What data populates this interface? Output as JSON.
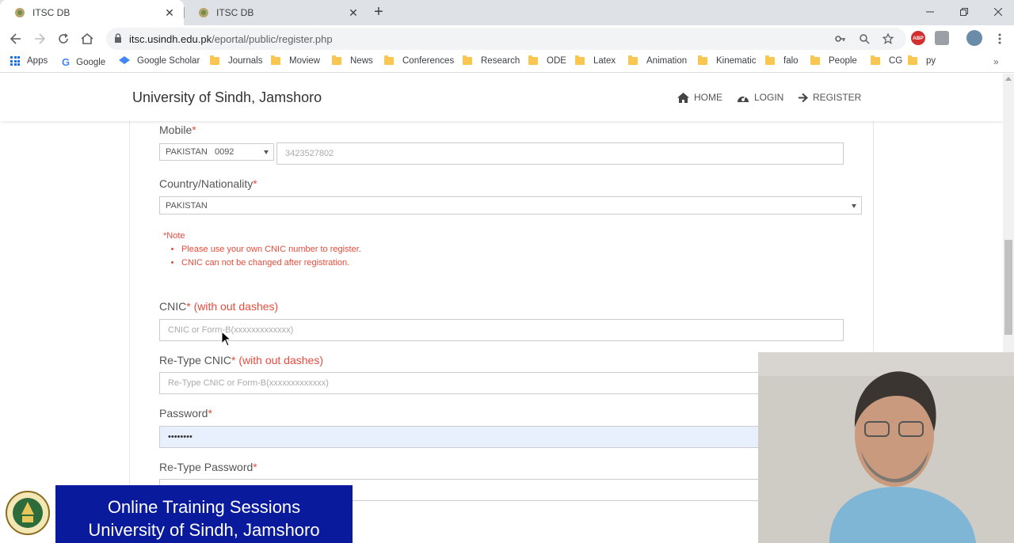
{
  "browser": {
    "tabs": [
      {
        "title": "ITSC DB",
        "active": true
      },
      {
        "title": "ITSC DB",
        "active": false
      }
    ],
    "url_host": "itsc.usindh.edu.pk",
    "url_path": "/eportal/public/register.php",
    "bookmarks": [
      "Apps",
      "Google",
      "Google Scholar",
      "Journals",
      "Moview",
      "News",
      "Conferences",
      "Research",
      "ODE",
      "Latex",
      "Animation",
      "Kinematic",
      "falo",
      "People",
      "CG",
      "py"
    ],
    "bookmarks_more": "»",
    "extension_label": "ABP"
  },
  "site": {
    "brand": "University of Sindh, Jamshoro",
    "nav": {
      "home": "HOME",
      "login": "LOGIN",
      "register": "REGISTER"
    }
  },
  "form": {
    "mobile_label": "Mobile",
    "required_mark": "*",
    "mobile_country": "PAKISTAN",
    "mobile_code": "0092",
    "mobile_value": "3423527802",
    "nationality_label": "Country/Nationality",
    "nationality_value": "PAKISTAN",
    "note_title": "Note",
    "notes": [
      "Please use your own CNIC number to register.",
      "CNIC can not be changed after registration."
    ],
    "cnic_label": "CNIC",
    "cnic_hint": "(with out dashes)",
    "cnic_placeholder": "CNIC or Form-B(xxxxxxxxxxxxx)",
    "recnic_label": "Re-Type CNIC",
    "recnic_hint": "(with out dashes)",
    "recnic_placeholder": "Re-Type CNIC or Form-B(xxxxxxxxxxxxx)",
    "password_label": "Password",
    "password_value": "••••••••",
    "repassword_label": "Re-Type Password"
  },
  "overlay": {
    "banner_line1": "Online Training Sessions",
    "banner_line2": "University of Sindh, Jamshoro"
  },
  "colors": {
    "required": "#e74c3c",
    "banner_bg": "#0a1a9c",
    "autofill_bg": "#e8f0fe"
  }
}
